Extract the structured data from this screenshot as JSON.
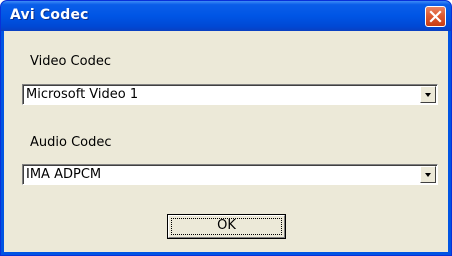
{
  "window": {
    "title": "Avi Codec"
  },
  "video": {
    "label": "Video Codec",
    "selected": "Microsoft Video 1"
  },
  "audio": {
    "label": "Audio Codec",
    "selected": "IMA ADPCM"
  },
  "buttons": {
    "ok_label": "OK"
  },
  "icons": {
    "close": "close-icon",
    "dropdown": "chevron-down-icon"
  },
  "colors": {
    "title_bar": "#0054e3",
    "close_button": "#de5a31",
    "dialog_background": "#ece9d8"
  }
}
